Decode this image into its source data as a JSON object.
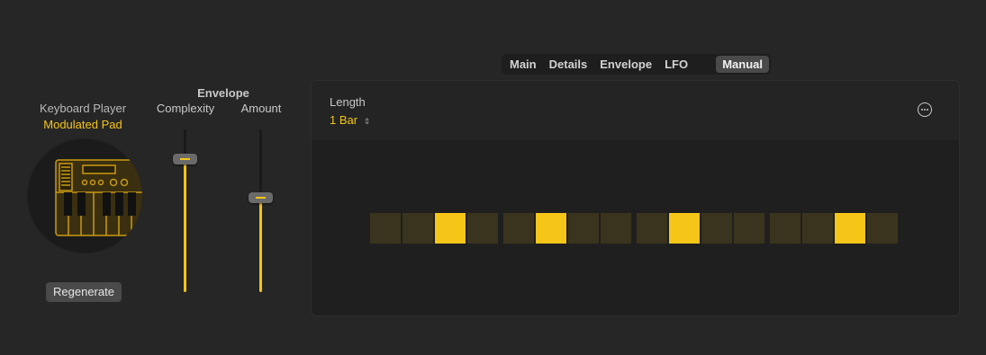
{
  "tabs": [
    {
      "label": "Main",
      "active": false
    },
    {
      "label": "Details",
      "active": false
    },
    {
      "label": "Envelope",
      "active": false
    },
    {
      "label": "LFO",
      "active": false
    },
    {
      "label": "Manual",
      "active": true
    }
  ],
  "player": {
    "title": "Keyboard Player",
    "preset": "Modulated Pad",
    "icon": "synth-keyboard-icon",
    "regenerate_label": "Regenerate"
  },
  "envelope": {
    "title": "Envelope",
    "complexity": {
      "label": "Complexity",
      "value": 0.82
    },
    "amount": {
      "label": "Amount",
      "value": 0.58
    }
  },
  "manual": {
    "length_label": "Length",
    "length_value": "1 Bar",
    "more_icon": "ellipsis-circle-icon",
    "steps": [
      0,
      0,
      1,
      0,
      0,
      1,
      0,
      0,
      0,
      1,
      0,
      0,
      0,
      0,
      1,
      0
    ]
  },
  "colors": {
    "accent": "#f5c518",
    "background": "#262626",
    "step_off": "#3a341e"
  }
}
